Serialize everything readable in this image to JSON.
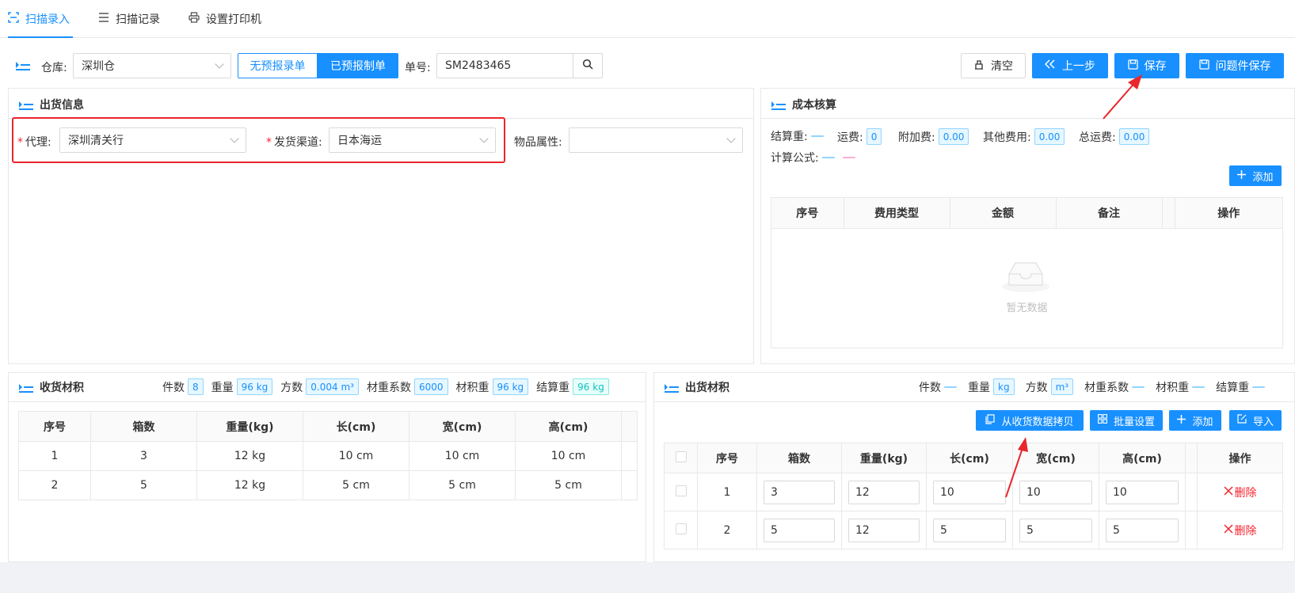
{
  "tabs": [
    {
      "label": "扫描录入",
      "icon": "scan-icon"
    },
    {
      "label": "扫描记录",
      "icon": "list-icon"
    },
    {
      "label": "设置打印机",
      "icon": "printer-icon"
    }
  ],
  "toolbar": {
    "warehouse_label": "仓库:",
    "warehouse_value": "深圳仓",
    "toggle_unreported": "无预报录单",
    "toggle_reported": "已预报制单",
    "order_label": "单号:",
    "order_value": "SM2483465",
    "clear_label": "清空",
    "prev_label": "上一步",
    "save_label": "保存",
    "problem_save_label": "问题件保存"
  },
  "shipping_info": {
    "title": "出货信息",
    "agent_label": "代理:",
    "agent_value": "深圳清关行",
    "channel_label": "发货渠道:",
    "channel_value": "日本海运",
    "attr_label": "物品属性:",
    "attr_value": ""
  },
  "cost": {
    "title": "成本核算",
    "settle_weight_label": "结算重:",
    "freight_label": "运费:",
    "freight_value": "0",
    "surcharge_label": "附加费:",
    "surcharge_value": "0.00",
    "other_label": "其他费用:",
    "other_value": "0.00",
    "total_label": "总运费:",
    "total_value": "0.00",
    "formula_label": "计算公式:",
    "add_label": "添加",
    "columns": [
      "序号",
      "费用类型",
      "金额",
      "备注",
      "操作"
    ],
    "empty_text": "暂无数据"
  },
  "received": {
    "title": "收货材积",
    "stats": [
      {
        "label": "件数",
        "value": "8",
        "style": "blue"
      },
      {
        "label": "重量",
        "value": "96 kg",
        "style": "blue"
      },
      {
        "label": "方数",
        "value": "0.004 m³",
        "style": "blue"
      },
      {
        "label": "材重系数",
        "value": "6000",
        "style": "blue"
      },
      {
        "label": "材积重",
        "value": "96 kg",
        "style": "blue"
      },
      {
        "label": "结算重",
        "value": "96 kg",
        "style": "green"
      }
    ],
    "columns": [
      "序号",
      "箱数",
      "重量(kg)",
      "长(cm)",
      "宽(cm)",
      "高(cm)"
    ],
    "rows": [
      [
        "1",
        "3",
        "12 kg",
        "10 cm",
        "10 cm",
        "10 cm"
      ],
      [
        "2",
        "5",
        "12 kg",
        "5 cm",
        "5 cm",
        "5 cm"
      ]
    ]
  },
  "outbound": {
    "title": "出货材积",
    "stats": [
      {
        "label": "件数",
        "value": ""
      },
      {
        "label": "重量",
        "value": "kg"
      },
      {
        "label": "方数",
        "value": "m³"
      },
      {
        "label": "材重系数",
        "value": ""
      },
      {
        "label": "材积重",
        "value": ""
      },
      {
        "label": "结算重",
        "value": ""
      }
    ],
    "copy_label": "从收货数据拷贝",
    "batch_label": "批量设置",
    "add_label": "添加",
    "import_label": "导入",
    "columns": [
      "序号",
      "箱数",
      "重量(kg)",
      "长(cm)",
      "宽(cm)",
      "高(cm)",
      "操作"
    ],
    "delete_label": "删除",
    "rows": [
      [
        "1",
        "3",
        "12",
        "10",
        "10",
        "10"
      ],
      [
        "2",
        "5",
        "12",
        "5",
        "5",
        "5"
      ]
    ]
  },
  "colors": {
    "accent": "#1890ff",
    "danger": "#f5222d",
    "highlight": "#e8262b"
  }
}
